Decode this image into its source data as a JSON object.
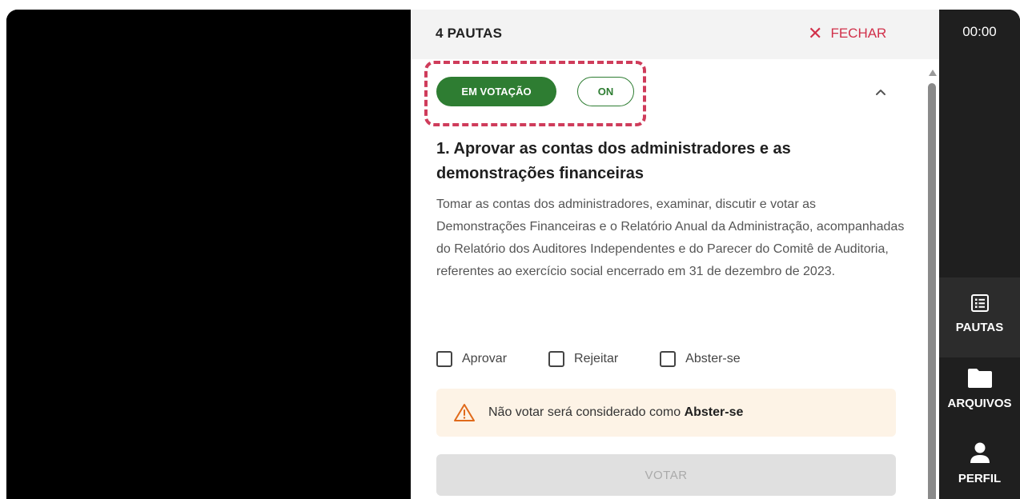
{
  "panel": {
    "title": "4 PAUTAS",
    "close_label": "FECHAR",
    "status_badge": "EM VOTAÇÃO",
    "live_badge": "ON"
  },
  "item": {
    "title": "1. Aprovar as contas dos administradores e as demonstrações financeiras",
    "description": "Tomar as contas dos administradores, examinar, discutir e votar as Demonstrações Financeiras e o Relatório Anual da Administração, acompanhadas do Relatório dos Auditores Independentes e do Parecer do Comitê de Auditoria, referentes ao exercício social encerrado em 31 de dezembro de 2023.",
    "options": [
      "Aprovar",
      "Rejeitar",
      "Abster-se"
    ],
    "warning_text": "Não votar será considerado como",
    "warning_bold": "Abster-se",
    "vote_label": "VOTAR"
  },
  "sidebar": {
    "timer": "00:00",
    "nav": [
      {
        "label": "PAUTAS",
        "icon": "list-icon",
        "active": true
      },
      {
        "label": "ARQUIVOS",
        "icon": "folder-icon",
        "active": false
      },
      {
        "label": "PERFIL",
        "icon": "user-icon",
        "active": false
      }
    ]
  },
  "colors": {
    "accent_green": "#2e7d32",
    "close_red": "#d1304a",
    "highlight_dashed": "#cf3c5b",
    "warning_bg": "#fdf3e6",
    "warning_icon": "#e06a1b",
    "sidebar_bg": "#1f1f1f"
  }
}
